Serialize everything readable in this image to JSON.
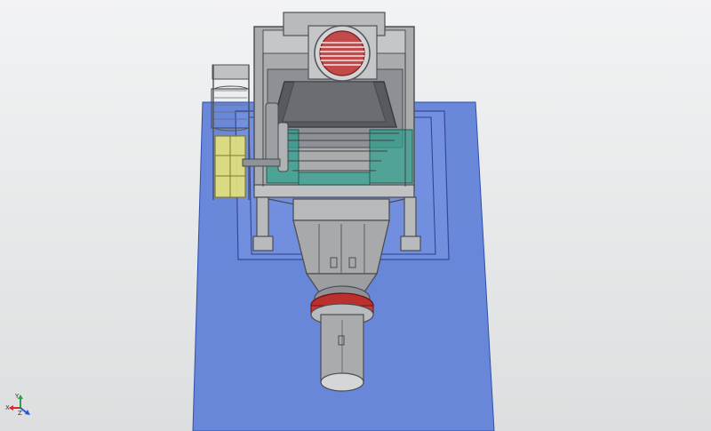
{
  "view": {
    "axis_triad": {
      "x_label": "X",
      "y_label": "Y",
      "z_label": "Z"
    }
  },
  "colors": {
    "background": "#e7e8ea",
    "base_plate": "#5e7fd8",
    "steel": "#a9abad",
    "steel_dark": "#5f6266",
    "steel_light": "#d7d8d9",
    "teal": "#2e9f8d",
    "yellow": "#e7e27a",
    "red": "#c62b2b"
  }
}
